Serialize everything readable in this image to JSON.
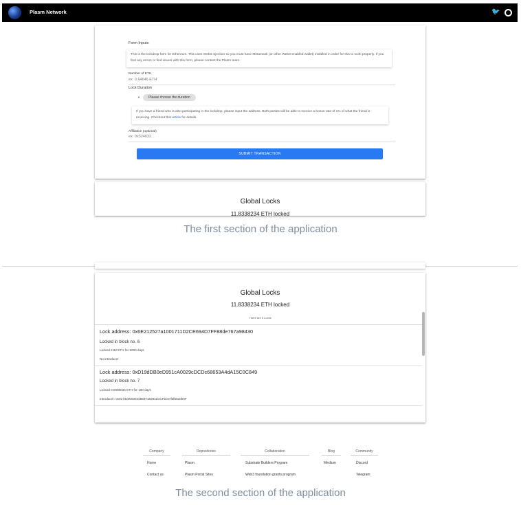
{
  "header": {
    "brand": "Plasm Network",
    "social": [
      "twitter-icon",
      "github-icon"
    ]
  },
  "form": {
    "title": "Form Inputs",
    "intro": "This is the lockdrop form for Ethereum. This uses Web3 injection so you must have Metamask (or other Web3-enabled wallet) installed in order for this to work properly. If you find any errors or find issues with this form, please contact the Plasm team.",
    "eth_label": "Number of ETH",
    "eth_placeholder": "ex: 0.64646 ETH",
    "duration_label": "Lock Duration",
    "duration_chip": "Please choose the duration",
    "friend_text": "If you have a friend who is also participating in the lockdrop, please input the address. Both parties will be able to receive a bonus rate of 1% of what the friend is receiving. Checkout this",
    "friend_link": "article",
    "friend_tail": "for details.",
    "affiliation_label": "Affiliation (optional)",
    "affiliation_placeholder": "ex: 0x324632...",
    "submit": "SUBMIT TRANSACTION"
  },
  "global": {
    "title": "Global Locks",
    "locked": "11.8338234 ETH locked",
    "count_text": "There are 5 Locks"
  },
  "locks": [
    {
      "address": "Lock address: 0x6E212527a1001711D2CE694D7FF88de767a98430",
      "block": "Locked in block no. 6",
      "amount": "Locked 2.82 ETH for 1000 days",
      "introducer": "No introducer"
    },
    {
      "address": "Lock address: 0xD19dDB0eD951cA0029cDCDc68653A4dA15C0C849",
      "block": "Locked in block no. 7",
      "amount": "Locked 0.0000034 ETH for 100 days",
      "introducer": "Introducer: 0x01734005354d56971829cD1CFbc67f3f56a0b6F"
    }
  ],
  "captions": {
    "first": "The first section of the application",
    "second": "The second section of the application"
  },
  "footer": {
    "columns": [
      {
        "heading": "Company",
        "items": [
          "Home",
          "Contact us"
        ]
      },
      {
        "heading": "Repositories",
        "items": [
          "Plasm",
          "Plasm Portal Sites"
        ]
      },
      {
        "heading": "Collaboration",
        "items": [
          "Substrate Builders Program",
          "Web3 foundation grants program"
        ]
      },
      {
        "heading": "Blog",
        "items": [
          "Medium"
        ]
      },
      {
        "heading": "Community",
        "items": [
          "Discord",
          "Telegram"
        ]
      }
    ]
  }
}
